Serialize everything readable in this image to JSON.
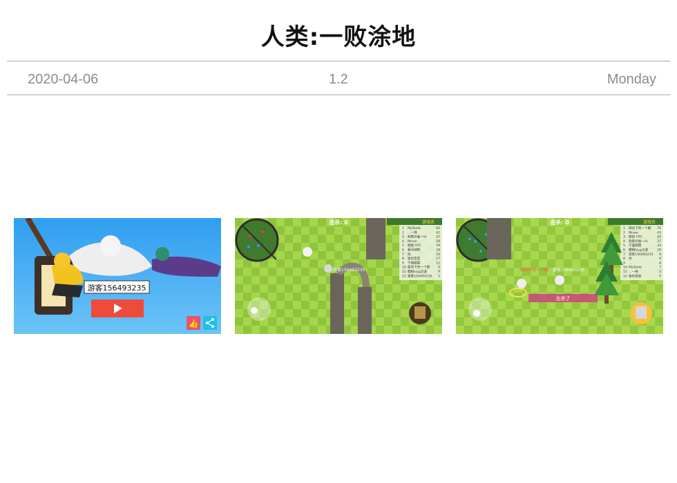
{
  "app": {
    "title": "人类:一败涂地"
  },
  "meta": {
    "date": "2020-04-06",
    "version": "1.2",
    "weekday": "Monday"
  },
  "screenshots": [
    {
      "caption": "游客156493235"
    },
    {
      "score": "击杀: 0",
      "player": "游客156493235",
      "rank_badge": "游戏名",
      "leaderboard": [
        {
          "rank": "1",
          "name": "MyTomb",
          "score": "60"
        },
        {
          "rank": "2",
          "name": "…一样",
          "score": "41"
        },
        {
          "rank": "3",
          "name": "刺客卯金一id",
          "score": "37"
        },
        {
          "rank": "4",
          "name": "Mcner",
          "score": "29"
        },
        {
          "rank": "5",
          "name": "傲视 HTC",
          "score": "29"
        },
        {
          "rank": "6",
          "name": "我马骑鸭",
          "score": "28"
        },
        {
          "rank": "7",
          "name": "你",
          "score": "19"
        },
        {
          "rank": "8",
          "name": "迷彩宏定",
          "score": "17"
        },
        {
          "rank": "9",
          "name": "千里眼陌",
          "score": "12"
        },
        {
          "rank": "10",
          "name": "晨光下的一个眼",
          "score": "9"
        },
        {
          "rank": "11",
          "name": "樱桃kiyg汉波",
          "score": "9"
        },
        {
          "rank": "12",
          "name": "游客156493235",
          "score": "1"
        }
      ]
    },
    {
      "score": "击杀: 0",
      "player": "游客156493235",
      "ally": "阳光下的一个眼",
      "kill_text": "击杀了",
      "rank_badge": "游戏名",
      "leaderboard": [
        {
          "rank": "1",
          "name": "阳光下的一个眼",
          "score": "70"
        },
        {
          "rank": "2",
          "name": "Mcner",
          "score": "43"
        },
        {
          "rank": "3",
          "name": "傲视 HTC",
          "score": "42"
        },
        {
          "rank": "4",
          "name": "刺客卯金一id",
          "score": "37"
        },
        {
          "rank": "5",
          "name": "千里眼陌",
          "score": "34"
        },
        {
          "rank": "6",
          "name": "樱桃kiyg汉波",
          "score": "29"
        },
        {
          "rank": "7",
          "name": "游客156493235",
          "score": "9"
        },
        {
          "rank": "8",
          "name": "你",
          "score": "9"
        },
        {
          "rank": "9",
          "name": "…",
          "score": "8"
        },
        {
          "rank": "10",
          "name": "MyTomb",
          "score": "7"
        },
        {
          "rank": "11",
          "name": "…一样",
          "score": "5"
        },
        {
          "rank": "12",
          "name": "迷彩宏定",
          "score": "5"
        }
      ]
    }
  ],
  "colors": {
    "sky": "#3aa6f0",
    "grass": "#9bd04a",
    "red": "#f04a3a",
    "text": "#111111",
    "muted": "#8c8c8c"
  }
}
